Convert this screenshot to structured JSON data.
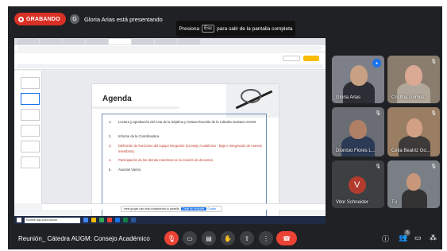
{
  "recording": {
    "label": "GRABANDO"
  },
  "presenter": {
    "text": "Gloria Arias está presentando",
    "avatar": "G"
  },
  "fullscreen_hint": {
    "before": "Presiona",
    "key": "Esc",
    "after": "para salir de la pantalla completa"
  },
  "slide": {
    "title": "Agenda",
    "items": [
      {
        "num": "1.",
        "text": "Lectura y aprobación del Acta de la Séptima y Octava Reunión de la Cátedra Gustavo AUGM.",
        "style": "normal"
      },
      {
        "num": "2.",
        "text": "Informe de la Coordinadora.",
        "style": "normal"
      },
      {
        "num": "3.",
        "text": "Definición de funciones del equipo integrante (Consejo Académico - Bajo e integración de nuevos miembros).",
        "style": "red"
      },
      {
        "num": "4.",
        "text": "Participación de los demás miembros en la reunión de docentes.",
        "style": "red"
      },
      {
        "num": "5.",
        "text": "Asuntos Varios.",
        "style": "normal"
      }
    ]
  },
  "share_notice": {
    "text": "meet.google.com está compartiendo tu pantalla.",
    "stop": "Dejar de compartir",
    "hide": "Ocultar"
  },
  "taskbar": {
    "search_placeholder": "Escribe aquí para buscar"
  },
  "participants": [
    {
      "name": "Gloria Arias"
    },
    {
      "name": "Cristina Gomes"
    },
    {
      "name": "Dionisio Flores L..."
    },
    {
      "name": "Célia Beatriz Go..."
    },
    {
      "name": "Vitor Schneider",
      "avatar": "V"
    },
    {
      "name": "Tú"
    }
  ],
  "meeting": {
    "title": "Reunión_ Cátedra AUGM: Consejo Académico"
  },
  "controls": {
    "mic": "mic-off-icon",
    "camera": "camera-icon",
    "captions": "captions-icon",
    "hand": "hand-icon",
    "present": "present-icon",
    "more": "more-icon",
    "end": "end-call-icon"
  },
  "right_controls": {
    "people_count": "6"
  },
  "colors": {
    "meet_bg": "#202124",
    "tile_bg": "#3c4043",
    "end_red": "#ea4335",
    "accent_blue": "#1a73e8"
  }
}
